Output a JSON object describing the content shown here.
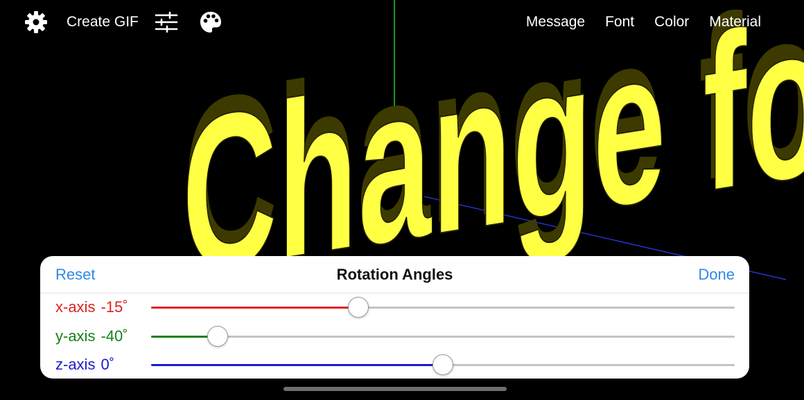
{
  "toolbar": {
    "settings_icon": "gear-icon",
    "create_gif_label": "Create GIF",
    "sliders_icon": "sliders-icon",
    "palette_icon": "palette-icon",
    "menu_items": [
      "Message",
      "Font",
      "Color",
      "Material"
    ]
  },
  "scene": {
    "text": "Change font",
    "text_color": "#ffff44",
    "extrusion_color": "#3d3a00",
    "axis_colors": {
      "y": "#22cc22",
      "z": "#2233cc"
    }
  },
  "panel": {
    "reset_label": "Reset",
    "title": "Rotation Angles",
    "done_label": "Done",
    "axes": [
      {
        "label": "x-axis",
        "value": "-15˚",
        "color": "#e02020",
        "fraction": 0.355
      },
      {
        "label": "y-axis",
        "value": "-40˚",
        "color": "#168016",
        "fraction": 0.114
      },
      {
        "label": "z-axis",
        "value": "0˚",
        "color": "#1a1acc",
        "fraction": 0.5
      }
    ]
  }
}
